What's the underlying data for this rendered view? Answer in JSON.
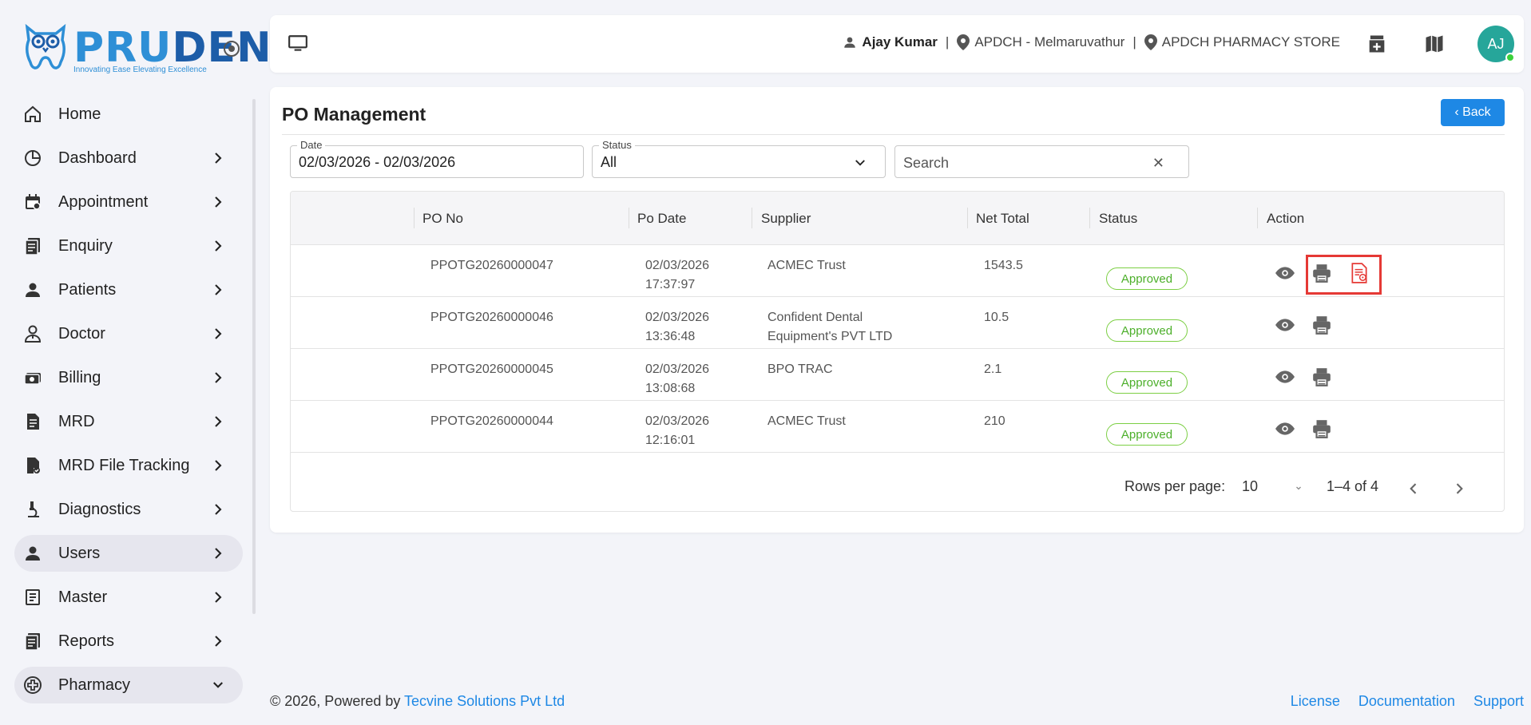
{
  "brand": {
    "name_part1": "PRU",
    "name_part2": "DENT",
    "tagline": "Innovating Ease Elevating Excellence"
  },
  "sidebar": {
    "items": [
      {
        "label": "Home",
        "icon": "home-icon",
        "chevron": "none",
        "active": false
      },
      {
        "label": "Dashboard",
        "icon": "dashboard-icon",
        "chevron": "right",
        "active": false
      },
      {
        "label": "Appointment",
        "icon": "calendar-icon",
        "chevron": "right",
        "active": false
      },
      {
        "label": "Enquiry",
        "icon": "enquiry-icon",
        "chevron": "right",
        "active": false
      },
      {
        "label": "Patients",
        "icon": "person-icon",
        "chevron": "right",
        "active": false
      },
      {
        "label": "Doctor",
        "icon": "doctor-icon",
        "chevron": "right",
        "active": false
      },
      {
        "label": "Billing",
        "icon": "billing-icon",
        "chevron": "right",
        "active": false
      },
      {
        "label": "MRD",
        "icon": "document-icon",
        "chevron": "right",
        "active": false
      },
      {
        "label": "MRD File Tracking",
        "icon": "file-tracking-icon",
        "chevron": "right",
        "active": false
      },
      {
        "label": "Diagnostics",
        "icon": "microscope-icon",
        "chevron": "right",
        "active": false
      },
      {
        "label": "Users",
        "icon": "person-icon",
        "chevron": "right",
        "active": true
      },
      {
        "label": "Master",
        "icon": "master-icon",
        "chevron": "right",
        "active": false
      },
      {
        "label": "Reports",
        "icon": "reports-icon",
        "chevron": "right",
        "active": false
      },
      {
        "label": "Pharmacy",
        "icon": "pharmacy-icon",
        "chevron": "down",
        "active": true
      }
    ]
  },
  "header": {
    "user": "Ajay Kumar",
    "location": "APDCH - Melmaruvathur",
    "store": "APDCH PHARMACY STORE",
    "avatar_initials": "AJ",
    "separator": "|"
  },
  "page": {
    "title": "PO Management",
    "back_label": "‹ Back"
  },
  "filters": {
    "date_label": "Date",
    "date_value": "02/03/2026 - 02/03/2026",
    "status_label": "Status",
    "status_value": "All",
    "search_placeholder": "Search",
    "clear_symbol": "✕"
  },
  "table": {
    "columns": [
      "PO No",
      "Po Date",
      "Supplier",
      "Net Total",
      "Status",
      "Action"
    ],
    "rows": [
      {
        "po_no": "PPOTG20260000047",
        "date": "02/03/2026",
        "time": "17:37:97",
        "supplier_l1": "ACMEC Trust",
        "supplier_l2": "",
        "net_total": "1543.5",
        "status": "Approved",
        "has_extra_action": true
      },
      {
        "po_no": "PPOTG20260000046",
        "date": "02/03/2026",
        "time": "13:36:48",
        "supplier_l1": "Confident Dental",
        "supplier_l2": "Equipment's PVT LTD",
        "net_total": "10.5",
        "status": "Approved",
        "has_extra_action": false
      },
      {
        "po_no": "PPOTG20260000045",
        "date": "02/03/2026",
        "time": "13:08:68",
        "supplier_l1": "BPO TRAC",
        "supplier_l2": "",
        "net_total": "2.1",
        "status": "Approved",
        "has_extra_action": false
      },
      {
        "po_no": "PPOTG20260000044",
        "date": "02/03/2026",
        "time": "12:16:01",
        "supplier_l1": "ACMEC Trust",
        "supplier_l2": "",
        "net_total": "210",
        "status": "Approved",
        "has_extra_action": false
      }
    ]
  },
  "pagination": {
    "rows_per_page_label": "Rows per page:",
    "rows_per_page_value": "10",
    "range": "1–4 of 4"
  },
  "footer": {
    "copyright": "© 2026, Powered by ",
    "company": "Tecvine Solutions Pvt Ltd",
    "links": [
      "License",
      "Documentation",
      "Support"
    ]
  },
  "colors": {
    "primary": "#1e88e5",
    "approved_green": "#4caf2a",
    "highlight_red": "#e53935",
    "avatar": "#26a69a"
  }
}
